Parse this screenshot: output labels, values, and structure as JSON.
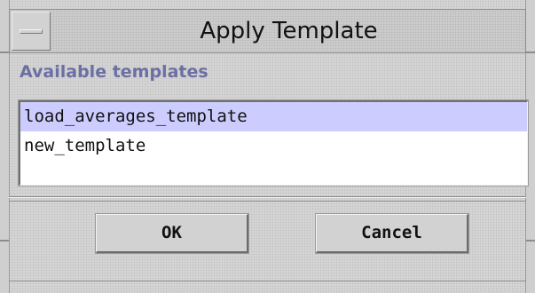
{
  "window": {
    "title": "Apply Template"
  },
  "section": {
    "label": "Available templates"
  },
  "templates": {
    "items": [
      {
        "label": "load_averages_template",
        "selected": true
      },
      {
        "label": "new_template",
        "selected": false
      }
    ]
  },
  "buttons": {
    "ok_label": "OK",
    "cancel_label": "Cancel"
  },
  "colors": {
    "selection": "#ccccff",
    "section_label": "#6b6fa3",
    "background": "#d6d6d6"
  },
  "icons": {
    "window_menu": "window-menu-icon"
  }
}
